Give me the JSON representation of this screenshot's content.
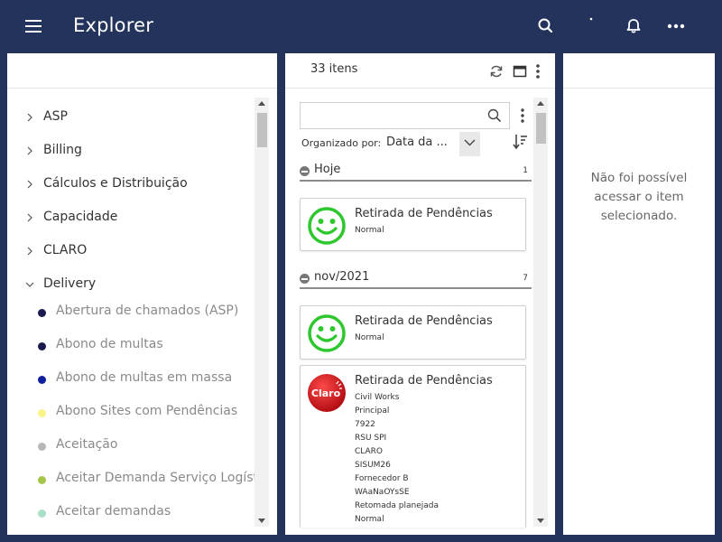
{
  "header": {
    "title": "Explorer",
    "icons": [
      "menu-icon",
      "search-icon",
      "notification-dot-icon",
      "bell-icon",
      "more-icon"
    ]
  },
  "tree": {
    "items": [
      {
        "label": "ASP",
        "expanded": false
      },
      {
        "label": "Billing",
        "expanded": false
      },
      {
        "label": "Cálculos e Distribuição",
        "expanded": false
      },
      {
        "label": "Capacidade",
        "expanded": false
      },
      {
        "label": "CLARO",
        "expanded": false
      },
      {
        "label": "Delivery",
        "expanded": true
      }
    ],
    "children": [
      {
        "label": "Abertura de chamados (ASP)",
        "color": "#1a1a4e"
      },
      {
        "label": "Abono de multas",
        "color": "#1a1a4e"
      },
      {
        "label": "Abono de multas em massa",
        "color": "#0f1f9e"
      },
      {
        "label": "Abono Sites com Pendências",
        "color": "#f7f48a"
      },
      {
        "label": "Aceitação",
        "color": "#b8b8b8"
      },
      {
        "label": "Aceitar Demanda Serviço Logística",
        "color": "#a5c64a"
      },
      {
        "label": "Aceitar demandas",
        "color": "#a8e0c8"
      }
    ]
  },
  "list": {
    "count": "33 itens",
    "search": {
      "placeholder": "",
      "value": ""
    },
    "organized_label": "Organizado por:",
    "organized_value": "Data da ...",
    "groups": [
      {
        "label": "Hoje",
        "count": "1"
      },
      {
        "label": "nov/2021",
        "count": "7"
      }
    ],
    "cards": [
      {
        "title": "Retirada de Pendências",
        "lines": [
          "Normal"
        ],
        "icon": "smiley-icon"
      },
      {
        "title": "Retirada de Pendências",
        "lines": [
          "Normal"
        ],
        "icon": "smiley-icon"
      },
      {
        "title": "Retirada de Pendências",
        "lines": [
          "Civil Works",
          "Principal",
          "7922",
          "RSU SPI",
          "CLARO",
          "SISUM26",
          "Fornecedor B",
          "WAaNaOYsSE",
          "Retomada planejada",
          "Normal"
        ],
        "icon": "claro-logo",
        "logo_text": "Claro"
      }
    ]
  },
  "detail": {
    "message": "Não foi possível acessar o item selecionado."
  },
  "colors": {
    "header_bg": "#23335c",
    "smiley": "#2ec82e",
    "claro_red": "#d3141b"
  }
}
